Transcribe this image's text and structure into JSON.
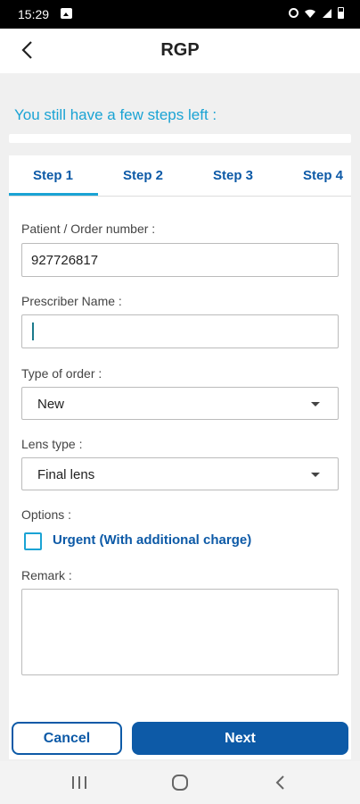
{
  "status_bar": {
    "time": "15:29",
    "icons": [
      "photo-icon",
      "alarm-icon",
      "wifi-icon",
      "signal-icon",
      "battery-icon"
    ]
  },
  "header": {
    "title": "RGP",
    "back_icon": "chevron-left-icon"
  },
  "progress": {
    "message": "You still have a few steps left :",
    "fraction": 0.0,
    "color": "#1aa3d4"
  },
  "tabs": [
    {
      "label": "Step 1",
      "active": true
    },
    {
      "label": "Step 2",
      "active": false
    },
    {
      "label": "Step 3",
      "active": false
    },
    {
      "label": "Step 4",
      "active": false
    }
  ],
  "form": {
    "order_number_label": "Patient / Order number :",
    "order_number_value": "927726817",
    "prescriber_label": "Prescriber Name :",
    "prescriber_value": "",
    "order_type_label": "Type of order :",
    "order_type_value": "New",
    "lens_type_label": "Lens type :",
    "lens_type_value": "Final lens",
    "options_label": "Options :",
    "urgent_label": "Urgent (With additional charge)",
    "urgent_checked": false,
    "remark_label": "Remark :",
    "remark_value": ""
  },
  "actions": {
    "cancel_label": "Cancel",
    "next_label": "Next"
  },
  "colors": {
    "accent": "#1aa3d4",
    "primary": "#0d5aa7"
  }
}
